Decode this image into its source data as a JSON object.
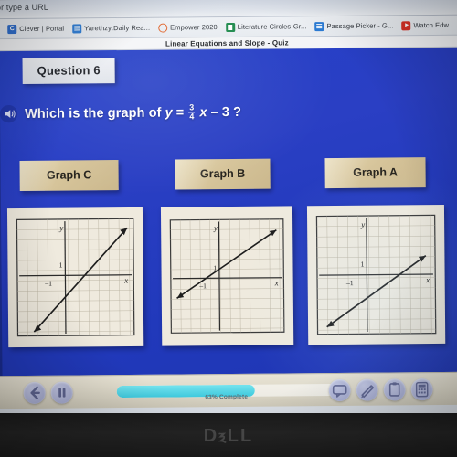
{
  "browser": {
    "url_placeholder": "or type a URL",
    "bookmarks": [
      {
        "label": "Clever | Portal",
        "icon": "clever-icon"
      },
      {
        "label": "Yarethzy:Daily Rea...",
        "icon": "doc-icon"
      },
      {
        "label": "Empower 2020",
        "icon": "ring-icon"
      },
      {
        "label": "Literature Circles-Gr...",
        "icon": "sheets-icon"
      },
      {
        "label": "Passage Picker - G...",
        "icon": "doc-icon"
      },
      {
        "label": "Watch Edw",
        "icon": "youtube-icon"
      }
    ]
  },
  "page": {
    "title": "Linear Equations and Slope - Quiz"
  },
  "quiz": {
    "question_badge": "Question 6",
    "speaker_icon": "speaker-icon",
    "question_prefix": "Which is the graph of",
    "equation": {
      "lhs": "y",
      "equals": "=",
      "numerator": "3",
      "denominator": "4",
      "variable": "x",
      "constant": "– 3",
      "question_mark": "?"
    },
    "choices": [
      {
        "label": "Graph C",
        "graph_id": "graph-c"
      },
      {
        "label": "Graph B",
        "graph_id": "graph-b"
      },
      {
        "label": "Graph A",
        "graph_id": "graph-a"
      }
    ],
    "graph_axis_labels": {
      "y": "y",
      "x": "x",
      "unit_y": "1",
      "unit_x": "–1"
    },
    "toolbar": {
      "back_icon": "back-arrow-icon",
      "pause_icon": "pause-icon",
      "chat_icon": "chat-bubble-icon",
      "pencil_icon": "pencil-icon",
      "notepad_icon": "notepad-icon",
      "calculator_icon": "calculator-icon",
      "progress_text": "63% Complete",
      "progress_percent": 63,
      "accent_color": "#3fc9dd"
    }
  },
  "device": {
    "brand": "DⲝLL"
  },
  "chart_data": [
    {
      "type": "line",
      "title": "Graph C",
      "xlabel": "x",
      "ylabel": "y",
      "xlim": [
        -6,
        6
      ],
      "ylim": [
        -6,
        6
      ],
      "grid": true,
      "series": [
        {
          "name": "line",
          "slope": 1.35,
          "intercept": -1.6,
          "points": [
            [
              -3.3,
              -6.0
            ],
            [
              4.0,
              3.8
            ]
          ]
        }
      ],
      "tick_labels": {
        "y_unit": "1",
        "x_unit": "-1"
      }
    },
    {
      "type": "line",
      "title": "Graph B",
      "xlabel": "x",
      "ylabel": "y",
      "xlim": [
        -6,
        6
      ],
      "ylim": [
        -6,
        6
      ],
      "grid": true,
      "series": [
        {
          "name": "line",
          "slope": 0.78,
          "intercept": 0.9,
          "points": [
            [
              -5.6,
              -3.5
            ],
            [
              5.1,
              4.9
            ]
          ]
        }
      ],
      "tick_labels": {
        "y_unit": "1",
        "x_unit": "-1"
      }
    },
    {
      "type": "line",
      "title": "Graph A",
      "xlabel": "x",
      "ylabel": "y",
      "xlim": [
        -6,
        6
      ],
      "ylim": [
        -6,
        6
      ],
      "grid": true,
      "series": [
        {
          "name": "line",
          "slope": 0.78,
          "intercept": -2.9,
          "points": [
            [
              -5.0,
              -5.7
            ],
            [
              5.0,
              2.1
            ]
          ]
        }
      ],
      "tick_labels": {
        "y_unit": "1",
        "x_unit": "-1"
      }
    }
  ]
}
